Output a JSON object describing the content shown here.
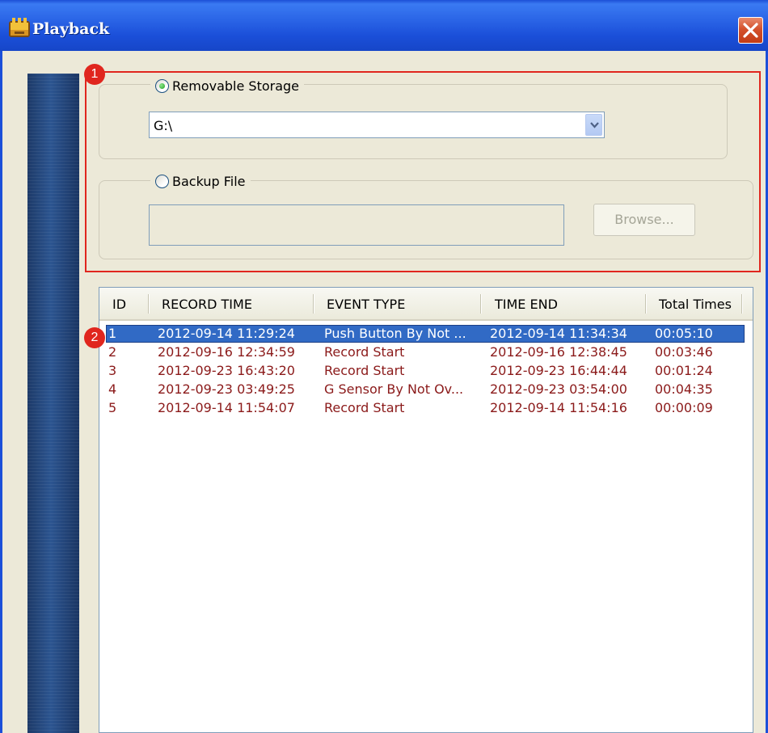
{
  "window": {
    "title": "Playback",
    "close_label": "close"
  },
  "markers": {
    "one": "1",
    "two": "2"
  },
  "storage": {
    "removable_label": "Removable Storage",
    "removable_selected": true,
    "drive_value": "G:\\",
    "backup_label": "Backup File",
    "backup_selected": false,
    "backup_path": "",
    "browse_label": "Browse..."
  },
  "records": {
    "columns": [
      "ID",
      "RECORD TIME",
      "EVENT TYPE",
      "TIME END",
      "Total Times"
    ],
    "rows": [
      {
        "id": "1",
        "record_time": "2012-09-14 11:29:24",
        "event_type": "Push Button By Not ...",
        "time_end": "2012-09-14 11:34:34",
        "total": "00:05:10",
        "selected": true
      },
      {
        "id": "2",
        "record_time": "2012-09-16 12:34:59",
        "event_type": "Record Start",
        "time_end": "2012-09-16 12:38:45",
        "total": "00:03:46",
        "selected": false
      },
      {
        "id": "3",
        "record_time": "2012-09-23 16:43:20",
        "event_type": "Record Start",
        "time_end": "2012-09-23 16:44:44",
        "total": "00:01:24",
        "selected": false
      },
      {
        "id": "4",
        "record_time": "2012-09-23 03:49:25",
        "event_type": "G Sensor By Not Ov...",
        "time_end": "2012-09-23 03:54:00",
        "total": "00:04:35",
        "selected": false
      },
      {
        "id": "5",
        "record_time": "2012-09-14 11:54:07",
        "event_type": "Record Start",
        "time_end": "2012-09-14 11:54:16",
        "total": "00:00:09",
        "selected": false
      }
    ]
  },
  "colors": {
    "titlebar": "#1b4fd9",
    "selection": "#316ac5",
    "row_text": "#8b1a1a",
    "annotation": "#e0261e"
  }
}
